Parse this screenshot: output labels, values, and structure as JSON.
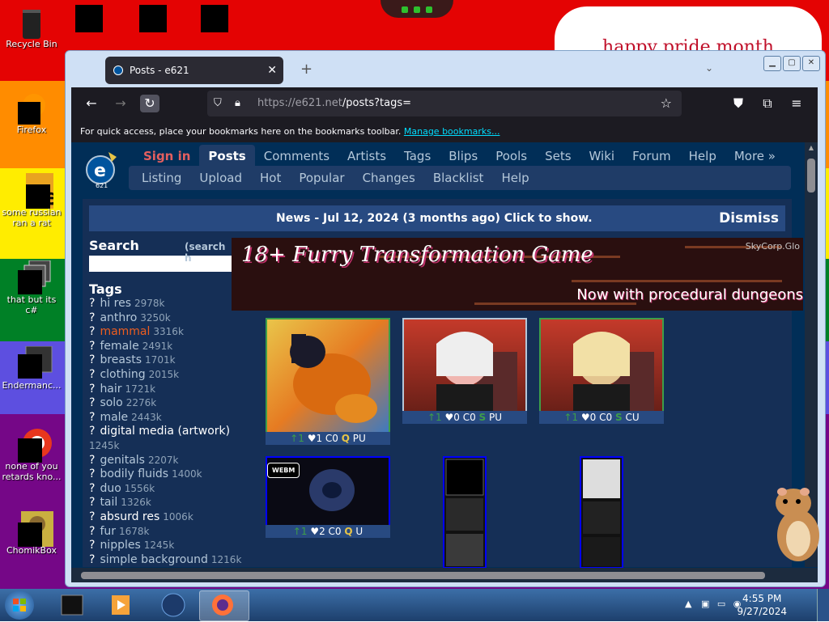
{
  "desktop": {
    "banner_text": "happy pride month",
    "icons": [
      {
        "name": "recycle-bin",
        "label": "Recycle Bin"
      },
      {
        "name": "firefox",
        "label": "Firefox"
      },
      {
        "name": "some-russian",
        "label": "some russian ran a rat"
      },
      {
        "name": "that-but-its",
        "label": "that but its c#"
      },
      {
        "name": "endermanc",
        "label": "Endermanc..."
      },
      {
        "name": "none-of-you",
        "label": "none of you retards kno..."
      },
      {
        "name": "chomikbox",
        "label": "ChomikBox"
      }
    ]
  },
  "browser": {
    "tab_title": "Posts - e621",
    "tab_close": "✕",
    "new_tab": "+",
    "url_host": "https://e621.net",
    "url_path": "/posts?tags=",
    "bookmarks_msg": "For quick access, place your bookmarks here on the bookmarks toolbar.",
    "bookmarks_link": "Manage bookmarks..."
  },
  "site": {
    "nav": [
      "Sign in",
      "Posts",
      "Comments",
      "Artists",
      "Tags",
      "Blips",
      "Pools",
      "Sets",
      "Wiki",
      "Forum",
      "Help",
      "More »"
    ],
    "subnav": [
      "Listing",
      "Upload",
      "Hot",
      "Popular",
      "Changes",
      "Blacklist",
      "Help"
    ],
    "news": "News - Jul 12, 2024 (3 months ago) Click to show.",
    "dismiss": "Dismiss",
    "search_heading": "Search",
    "search_help": "(search h",
    "tags_heading": "Tags",
    "tags": [
      {
        "name": "hi res",
        "count": "2978k",
        "kind": "general"
      },
      {
        "name": "anthro",
        "count": "3250k",
        "kind": "general"
      },
      {
        "name": "mammal",
        "count": "3316k",
        "kind": "species"
      },
      {
        "name": "female",
        "count": "2491k",
        "kind": "general"
      },
      {
        "name": "breasts",
        "count": "1701k",
        "kind": "general"
      },
      {
        "name": "clothing",
        "count": "2015k",
        "kind": "general"
      },
      {
        "name": "hair",
        "count": "1721k",
        "kind": "general"
      },
      {
        "name": "solo",
        "count": "2276k",
        "kind": "general"
      },
      {
        "name": "male",
        "count": "2443k",
        "kind": "general"
      },
      {
        "name": "digital media (artwork)",
        "count": "1245k",
        "kind": "meta"
      },
      {
        "name": "genitals",
        "count": "2207k",
        "kind": "general"
      },
      {
        "name": "bodily fluids",
        "count": "1400k",
        "kind": "general"
      },
      {
        "name": "duo",
        "count": "1556k",
        "kind": "general"
      },
      {
        "name": "tail",
        "count": "1326k",
        "kind": "general"
      },
      {
        "name": "absurd res",
        "count": "1006k",
        "kind": "meta"
      },
      {
        "name": "fur",
        "count": "1678k",
        "kind": "general"
      },
      {
        "name": "nipples",
        "count": "1245k",
        "kind": "general"
      },
      {
        "name": "simple background",
        "count": "1216k",
        "kind": "general"
      }
    ],
    "ad": {
      "title": "18+ Furry Transformation Game",
      "subtitle": "Now with procedural dungeons",
      "credit": "SkyCorp.Glo"
    },
    "posts": [
      {
        "up": "↑1",
        "fav": "♥1",
        "comments": "C0",
        "rating": "Q",
        "rating_color": "#e8c446",
        "extra": "PU",
        "border": "#3e9e49"
      },
      {
        "up": "↑1",
        "fav": "♥0",
        "comments": "C0",
        "rating": "S",
        "rating_color": "#3e9e49",
        "extra": "PU",
        "border": "#b4c7d9"
      },
      {
        "up": "↑1",
        "fav": "♥0",
        "comments": "C0",
        "rating": "S",
        "rating_color": "#3e9e49",
        "extra": "CU",
        "border": "#3e9e49"
      },
      {
        "up": "↑1",
        "fav": "♥2",
        "comments": "C0",
        "rating": "Q",
        "rating_color": "#e8c446",
        "extra": "U",
        "border": "#0000ff"
      }
    ],
    "webm_badge": "WEBM"
  },
  "taskbar": {
    "time": "4:55 PM",
    "date": "9/27/2024"
  }
}
